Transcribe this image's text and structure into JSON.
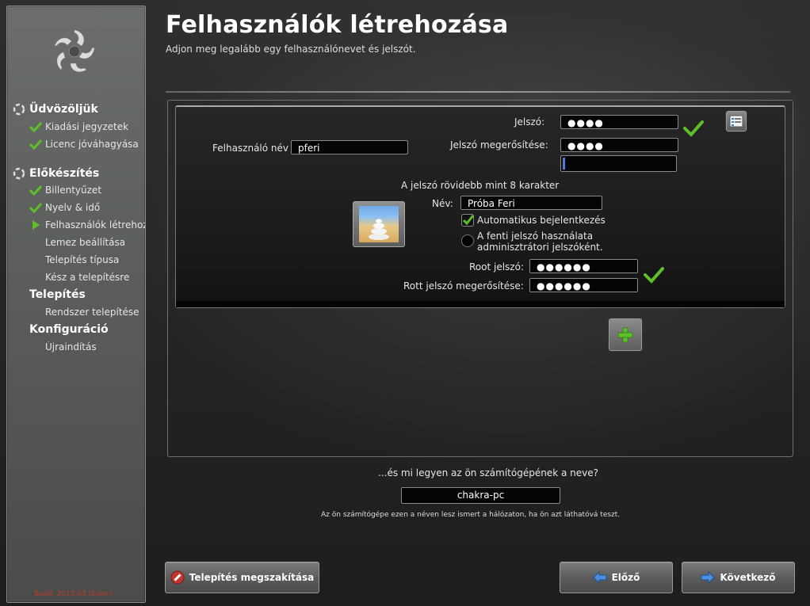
{
  "sidebar": {
    "sections": [
      {
        "title": "Üdvözöljük",
        "items": [
          {
            "label": "Kiadási jegyzetek",
            "state": "done"
          },
          {
            "label": "Licenc jóváhagyása",
            "state": "done"
          }
        ]
      },
      {
        "title": "Előkészítés",
        "items": [
          {
            "label": "Billentyűzet",
            "state": "done"
          },
          {
            "label": "Nyelv & idő",
            "state": "done"
          },
          {
            "label": "Felhasználók létrehozása",
            "state": "current"
          },
          {
            "label": "Lemez beállítása",
            "state": "pending"
          },
          {
            "label": "Telepítés típusa",
            "state": "pending"
          },
          {
            "label": "Kész a telepítésre",
            "state": "pending"
          }
        ]
      },
      {
        "title": "Telepítés",
        "items": [
          {
            "label": "Rendszer telepítése",
            "state": "pending"
          }
        ]
      },
      {
        "title": "Konfiguráció",
        "items": [
          {
            "label": "Újraindítás",
            "state": "pending"
          }
        ]
      }
    ],
    "build": "Build: 2015.03 (Euler)"
  },
  "header": {
    "title": "Felhasználók létrehozása",
    "subtitle": "Adjon meg legalább egy felhasználónevet és jelszót."
  },
  "user": {
    "username_label": "Felhasználó név",
    "username_value": "pferi",
    "password_label": "Jelszó:",
    "password_value": "●●●●",
    "password_confirm_label": "Jelszó megerősítése:",
    "password_confirm_value": "●●●●",
    "password_warning": "A jelszó rövidebb mint 8 karakter",
    "name_label": "Név:",
    "name_value": "Próba Feri",
    "autologin_label": "Automatikus bejelentkezés",
    "autologin_checked": true,
    "use_as_root_label_1": "A fenti jelszó használata",
    "use_as_root_label_2": "adminisztrátori jelszóként.",
    "use_as_root_checked": false,
    "root_password_label": "Root jelszó:",
    "root_password_value": "●●●●●●",
    "root_confirm_label": "Rott jelszó megerősítése:",
    "root_confirm_value": "●●●●●●"
  },
  "computer": {
    "question": "...és mi legyen az ön számítógépének a neve?",
    "hostname": "chakra-pc",
    "hint": "Az ön számítógépe ezen a néven lesz ismert a hálózaton, ha ön azt láthatóvá teszt."
  },
  "buttons": {
    "abort": "Telepítés megszakítása",
    "back": "Előző",
    "next": "Következő"
  },
  "colors": {
    "check_green": "#5fbf2a",
    "build_text": "#c0392b",
    "field_bg": "#050505"
  }
}
